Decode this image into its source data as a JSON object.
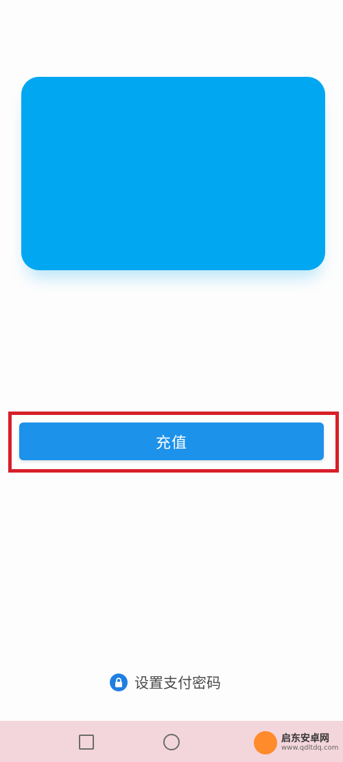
{
  "card": {
    "color": "#02a7f1"
  },
  "recharge": {
    "label": "充值",
    "color": "#1d92ea",
    "highlight_color": "#d71f2a"
  },
  "set_password": {
    "label": "设置支付密码",
    "icon": "lock-icon"
  },
  "nav": {
    "recent_icon": "square-icon",
    "home_icon": "circle-icon"
  },
  "watermark": {
    "title": "启东安卓网",
    "url": "www.qdltdq.com"
  }
}
